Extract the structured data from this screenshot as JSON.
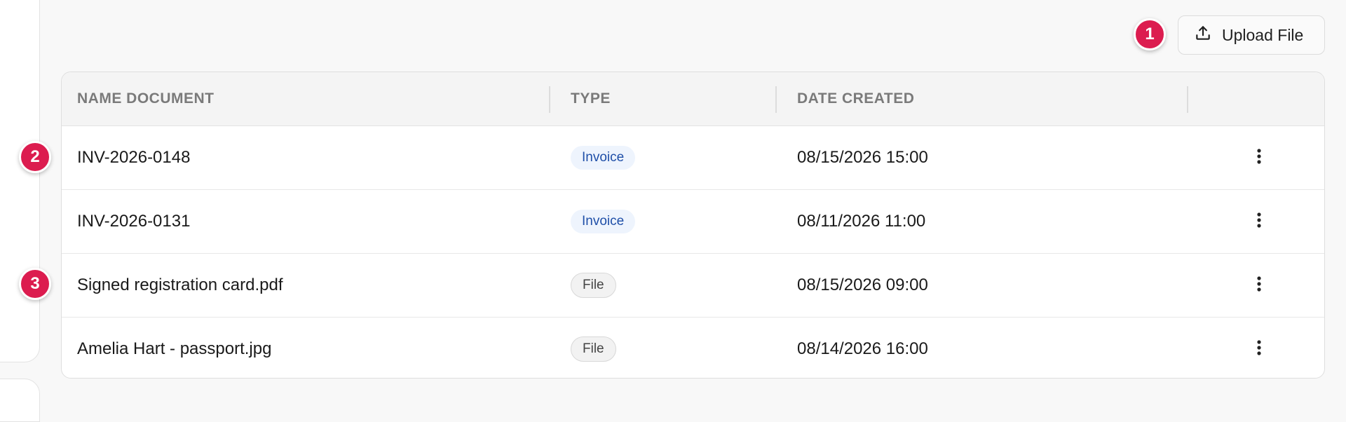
{
  "toolbar": {
    "upload_label": "Upload File"
  },
  "badges": [
    "1",
    "2",
    "3"
  ],
  "table": {
    "headers": {
      "name": "NAME DOCUMENT",
      "type": "TYPE",
      "date": "DATE CREATED"
    },
    "rows": [
      {
        "name": "INV-2026-0148",
        "type": "Invoice",
        "date": "08/15/2026 15:00"
      },
      {
        "name": "INV-2026-0131",
        "type": "Invoice",
        "date": "08/11/2026 11:00"
      },
      {
        "name": "Signed registration card.pdf",
        "type": "File",
        "date": "08/15/2026 09:00"
      },
      {
        "name": "Amelia Hart - passport.jpg",
        "type": "File",
        "date": "08/14/2026 16:00"
      }
    ]
  },
  "icons": {
    "upload": "upload-icon",
    "row_menu": "more-vertical-icon"
  },
  "colors": {
    "badge": "#dc1c4f",
    "invoice_pill_bg": "#eef4fd",
    "invoice_pill_text": "#1f4fa8"
  }
}
